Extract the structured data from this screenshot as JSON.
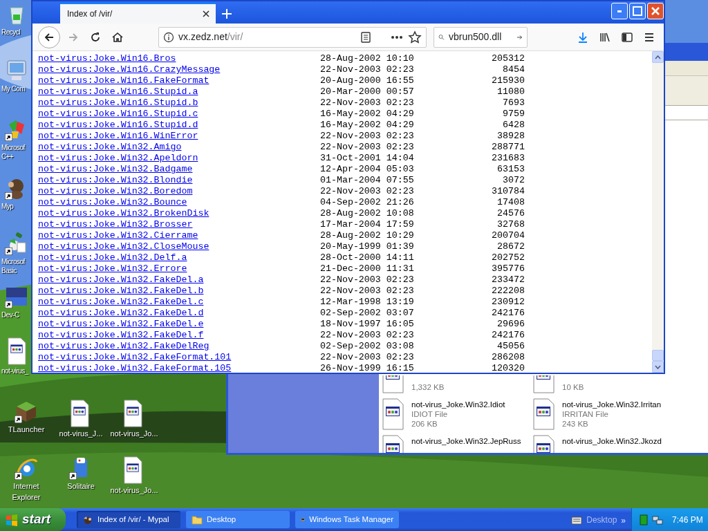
{
  "desktop_icons": [
    {
      "kind": "recycle",
      "lines": [
        "Recycl"
      ],
      "shortcut": false
    },
    {
      "kind": "computer",
      "lines": [
        "My Com"
      ],
      "shortcut": false
    },
    {
      "kind": "ide",
      "lines": [
        "Microsof",
        "C++"
      ],
      "shortcut": true
    },
    {
      "kind": "mascot",
      "lines": [
        "Myp"
      ],
      "shortcut": true
    },
    {
      "kind": "basic",
      "lines": [
        "Microsof",
        "Basic"
      ],
      "shortcut": true
    },
    {
      "kind": "devcpp",
      "lines": [
        "Dev-C"
      ],
      "shortcut": true
    },
    {
      "kind": "file",
      "lines": [
        "not-virus_"
      ],
      "shortcut": false
    },
    {
      "kind": "block",
      "lines": [
        "TLauncher"
      ],
      "shortcut": true
    },
    {
      "kind": "file",
      "lines": [
        "not-virus_J..."
      ],
      "shortcut": false
    },
    {
      "kind": "file",
      "lines": [
        "not-virus_Jo..."
      ],
      "shortcut": false
    },
    {
      "kind": "browser",
      "lines": [
        "Internet",
        "Explorer"
      ],
      "shortcut": true
    },
    {
      "kind": "cards",
      "lines": [
        "Solitaire"
      ],
      "shortcut": true
    },
    {
      "kind": "file",
      "lines": [
        "not-virus_Jo..."
      ],
      "shortcut": false
    }
  ],
  "explorer": {
    "tiles": [
      {
        "size": "1,332 KB"
      },
      {
        "size": "10 KB"
      },
      {
        "name": "not-virus_Joke.Win32.Idiot",
        "type": "IDIOT File",
        "size": "206 KB"
      },
      {
        "name": "not-virus_Joke.Win32.Irritan",
        "type": "IRRITAN File",
        "size": "243 KB"
      },
      {
        "name": "not-virus_Joke.Win32.JepRuss"
      },
      {
        "name": "not-virus_Joke.Win32.Jkozd"
      }
    ]
  },
  "browser": {
    "tab": {
      "title": "Index of /vir/"
    },
    "address": {
      "host": "vx.zedz.net",
      "path": "/vir/"
    },
    "search": "vbrun500.dll",
    "listing": [
      {
        "name": "not-virus:Joke.Win16.Bros",
        "date": "28-Aug-2002 10:10",
        "size": "205312"
      },
      {
        "name": "not-virus:Joke.Win16.CrazyMessage",
        "date": "22-Nov-2003 02:23",
        "size": "8454"
      },
      {
        "name": "not-virus:Joke.Win16.FakeFormat",
        "date": "20-Aug-2000 16:55",
        "size": "215930"
      },
      {
        "name": "not-virus:Joke.Win16.Stupid.a",
        "date": "20-Mar-2000 00:57",
        "size": "11080"
      },
      {
        "name": "not-virus:Joke.Win16.Stupid.b",
        "date": "22-Nov-2003 02:23",
        "size": "7693"
      },
      {
        "name": "not-virus:Joke.Win16.Stupid.c",
        "date": "16-May-2002 04:29",
        "size": "9759"
      },
      {
        "name": "not-virus:Joke.Win16.Stupid.d",
        "date": "16-May-2002 04:29",
        "size": "6428"
      },
      {
        "name": "not-virus:Joke.Win16.WinError",
        "date": "22-Nov-2003 02:23",
        "size": "38928"
      },
      {
        "name": "not-virus:Joke.Win32.Amigo",
        "date": "22-Nov-2003 02:23",
        "size": "288771"
      },
      {
        "name": "not-virus:Joke.Win32.Apeldorn",
        "date": "31-Oct-2001 14:04",
        "size": "231683"
      },
      {
        "name": "not-virus:Joke.Win32.Badgame",
        "date": "12-Apr-2004 05:03",
        "size": "63153"
      },
      {
        "name": "not-virus:Joke.Win32.Blondie",
        "date": "01-Mar-2004 07:55",
        "size": "3072"
      },
      {
        "name": "not-virus:Joke.Win32.Boredom",
        "date": "22-Nov-2003 02:23",
        "size": "310784"
      },
      {
        "name": "not-virus:Joke.Win32.Bounce",
        "date": "04-Sep-2002 21:26",
        "size": "17408"
      },
      {
        "name": "not-virus:Joke.Win32.BrokenDisk",
        "date": "28-Aug-2002 10:08",
        "size": "24576"
      },
      {
        "name": "not-virus:Joke.Win32.Brosser",
        "date": "17-Mar-2004 17:59",
        "size": "32768"
      },
      {
        "name": "not-virus:Joke.Win32.Cierrame",
        "date": "28-Aug-2002 10:29",
        "size": "200704"
      },
      {
        "name": "not-virus:Joke.Win32.CloseMouse",
        "date": "20-May-1999 01:39",
        "size": "28672"
      },
      {
        "name": "not-virus:Joke.Win32.Delf.a",
        "date": "28-Oct-2000 14:11",
        "size": "202752"
      },
      {
        "name": "not-virus:Joke.Win32.Errore",
        "date": "21-Dec-2000 11:31",
        "size": "395776"
      },
      {
        "name": "not-virus:Joke.Win32.FakeDel.a",
        "date": "22-Nov-2003 02:23",
        "size": "233472"
      },
      {
        "name": "not-virus:Joke.Win32.FakeDel.b",
        "date": "22-Nov-2003 02:23",
        "size": "222208"
      },
      {
        "name": "not-virus:Joke.Win32.FakeDel.c",
        "date": "12-Mar-1998 13:19",
        "size": "230912"
      },
      {
        "name": "not-virus:Joke.Win32.FakeDel.d",
        "date": "02-Sep-2002 03:07",
        "size": "242176"
      },
      {
        "name": "not-virus:Joke.Win32.FakeDel.e",
        "date": "18-Nov-1997 16:05",
        "size": "29696"
      },
      {
        "name": "not-virus:Joke.Win32.FakeDel.f",
        "date": "22-Nov-2003 02:23",
        "size": "242176"
      },
      {
        "name": "not-virus:Joke.Win32.FakeDelReg",
        "date": "02-Sep-2002 03:08",
        "size": "45056"
      },
      {
        "name": "not-virus:Joke.Win32.FakeFormat.101",
        "date": "22-Nov-2003 02:23",
        "size": "286208"
      },
      {
        "name": "not-virus:Joke.Win32.FakeFormat.105",
        "date": "26-Nov-1999 16:15",
        "size": "120320"
      }
    ]
  },
  "taskbar": {
    "start": "start",
    "tasks": [
      {
        "kind": "browser",
        "label": "Index of /vir/ - Mypal",
        "selected": true
      },
      {
        "kind": "folder",
        "label": "Desktop",
        "selected": false
      },
      {
        "kind": "monitor",
        "label": "Windows Task Manager",
        "selected": false
      }
    ],
    "toolbar": {
      "label": "Desktop",
      "chevron": "»"
    },
    "clock": "7:46 PM"
  }
}
